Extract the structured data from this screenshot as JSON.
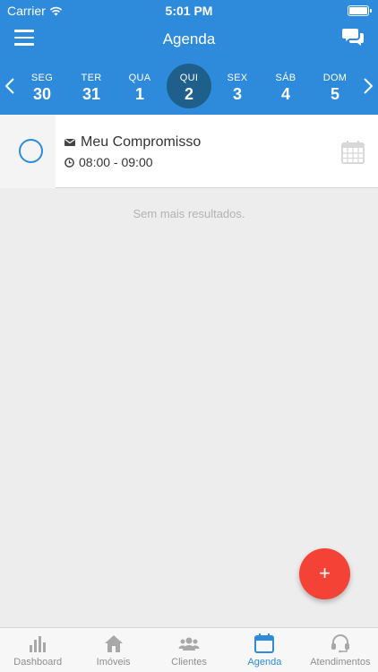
{
  "status_bar": {
    "carrier": "Carrier",
    "time": "5:01 PM"
  },
  "header": {
    "title": "Agenda"
  },
  "week": {
    "days": [
      {
        "name": "SEG",
        "number": "30",
        "selected": false
      },
      {
        "name": "TER",
        "number": "31",
        "selected": false
      },
      {
        "name": "QUA",
        "number": "1",
        "selected": false
      },
      {
        "name": "QUI",
        "number": "2",
        "selected": true
      },
      {
        "name": "SEX",
        "number": "3",
        "selected": false
      },
      {
        "name": "SÁB",
        "number": "4",
        "selected": false
      },
      {
        "name": "DOM",
        "number": "5",
        "selected": false
      }
    ]
  },
  "events": [
    {
      "title": "Meu Compromisso",
      "time": "08:00 - 09:00"
    }
  ],
  "empty_message": "Sem mais resultados.",
  "fab": {
    "label": "+"
  },
  "tabs": [
    {
      "label": "Dashboard",
      "icon": "chart-bar-icon",
      "active": false
    },
    {
      "label": "Imóveis",
      "icon": "home-icon",
      "active": false
    },
    {
      "label": "Clientes",
      "icon": "users-icon",
      "active": false
    },
    {
      "label": "Agenda",
      "icon": "calendar-icon",
      "active": true
    },
    {
      "label": "Atendimentos",
      "icon": "headset-icon",
      "active": false
    }
  ],
  "colors": {
    "primary": "#2e8bdc",
    "selected_day": "#1f5f8b",
    "fab": "#f44336",
    "background": "#ededed"
  }
}
